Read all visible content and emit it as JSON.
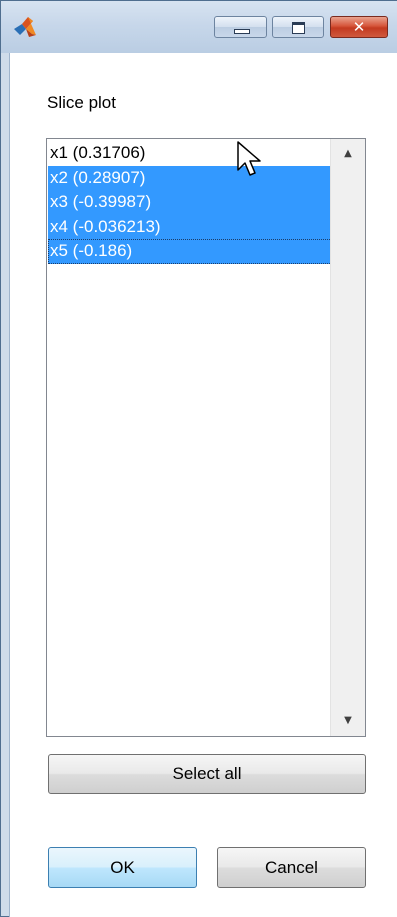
{
  "window": {
    "controls": {
      "minimize": "minimize-icon",
      "maximize": "maximize-icon",
      "close": "✕"
    }
  },
  "panel": {
    "label": "Slice plot"
  },
  "list": {
    "items": [
      {
        "label": "x1 (0.31706)",
        "selected": false
      },
      {
        "label": "x2 (0.28907)",
        "selected": true
      },
      {
        "label": "x3 (-0.39987)",
        "selected": true
      },
      {
        "label": "x4 (-0.036213)",
        "selected": true
      },
      {
        "label": "x5 (-0.186)",
        "selected": true,
        "focused": true
      }
    ],
    "scroll_up": "▲",
    "scroll_down": "▼"
  },
  "buttons": {
    "select_all": "Select all",
    "ok": "OK",
    "cancel": "Cancel"
  },
  "colors": {
    "selection": "#3399ff",
    "selection_text": "#ffffff",
    "close_button": "#c33a20",
    "titlebar": "#c7d7ea"
  }
}
